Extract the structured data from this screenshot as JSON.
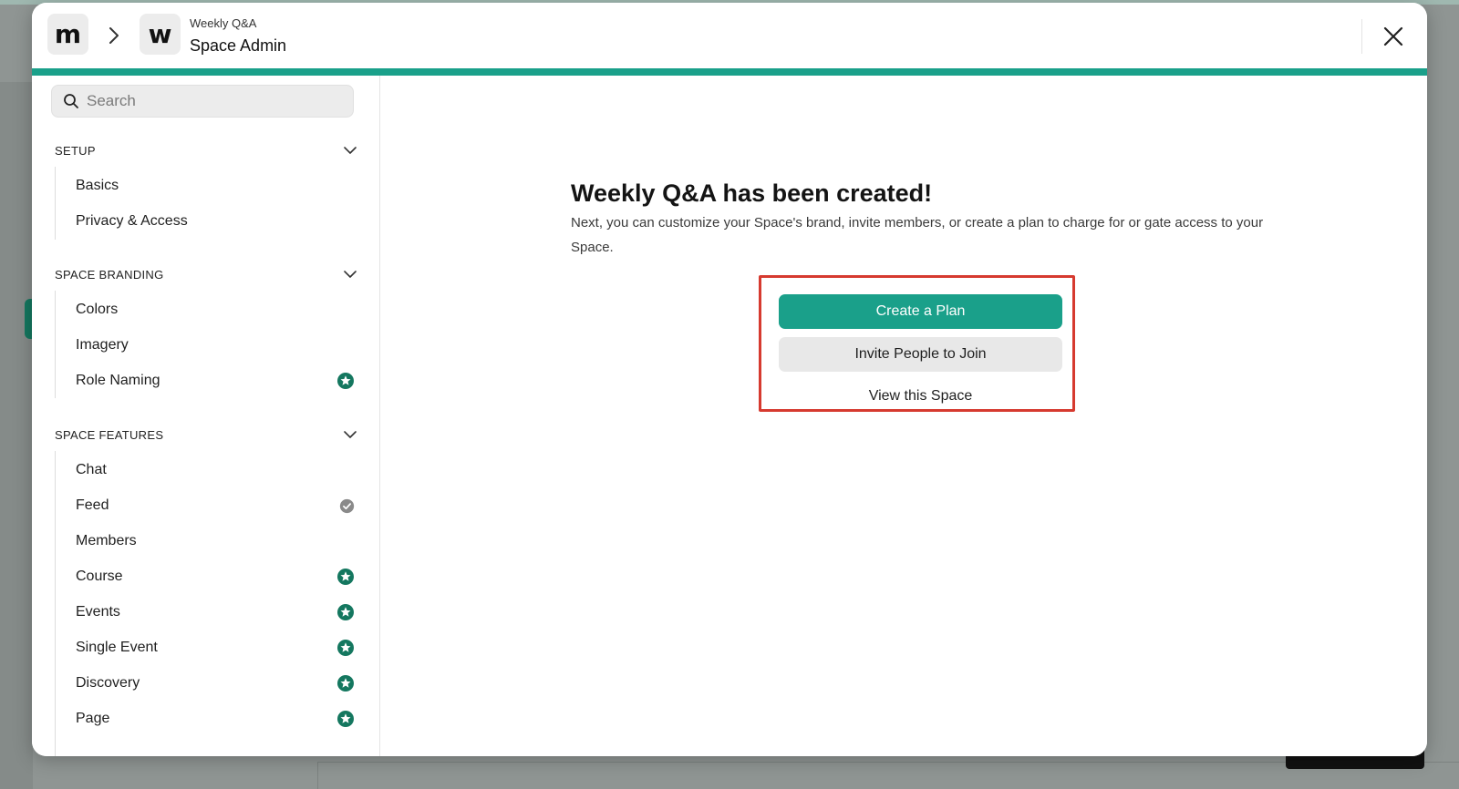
{
  "header": {
    "logo_app": "m",
    "logo_space": "w",
    "space_name": "Weekly Q&A",
    "title": "Space Admin"
  },
  "search": {
    "placeholder": "Search"
  },
  "sidebar": {
    "sections": [
      {
        "title": "SETUP",
        "items": [
          {
            "label": "Basics",
            "badge": null
          },
          {
            "label": "Privacy & Access",
            "badge": null
          }
        ]
      },
      {
        "title": "SPACE BRANDING",
        "items": [
          {
            "label": "Colors",
            "badge": null
          },
          {
            "label": "Imagery",
            "badge": null
          },
          {
            "label": "Role Naming",
            "badge": "star-badge-icon"
          }
        ]
      },
      {
        "title": "SPACE FEATURES",
        "items": [
          {
            "label": "Chat",
            "badge": null
          },
          {
            "label": "Feed",
            "badge": "check-circle-icon"
          },
          {
            "label": "Members",
            "badge": null
          },
          {
            "label": "Course",
            "badge": "star-badge-icon"
          },
          {
            "label": "Events",
            "badge": "star-badge-icon"
          },
          {
            "label": "Single Event",
            "badge": "star-badge-icon"
          },
          {
            "label": "Discovery",
            "badge": "star-badge-icon"
          },
          {
            "label": "Page",
            "badge": "star-badge-icon"
          }
        ]
      }
    ]
  },
  "main": {
    "headline": "Weekly Q&A has been created!",
    "subtext": "Next, you can customize your Space's brand, invite members, or create a plan to charge for or gate access to your Space.",
    "buttons": {
      "create_plan": "Create a Plan",
      "invite": "Invite People to Join",
      "view": "View this Space"
    }
  },
  "colors": {
    "accent": "#1aa08a",
    "badge_green": "#14775f",
    "badge_gray": "#8a8a8a",
    "highlight": "#d63a2f"
  }
}
